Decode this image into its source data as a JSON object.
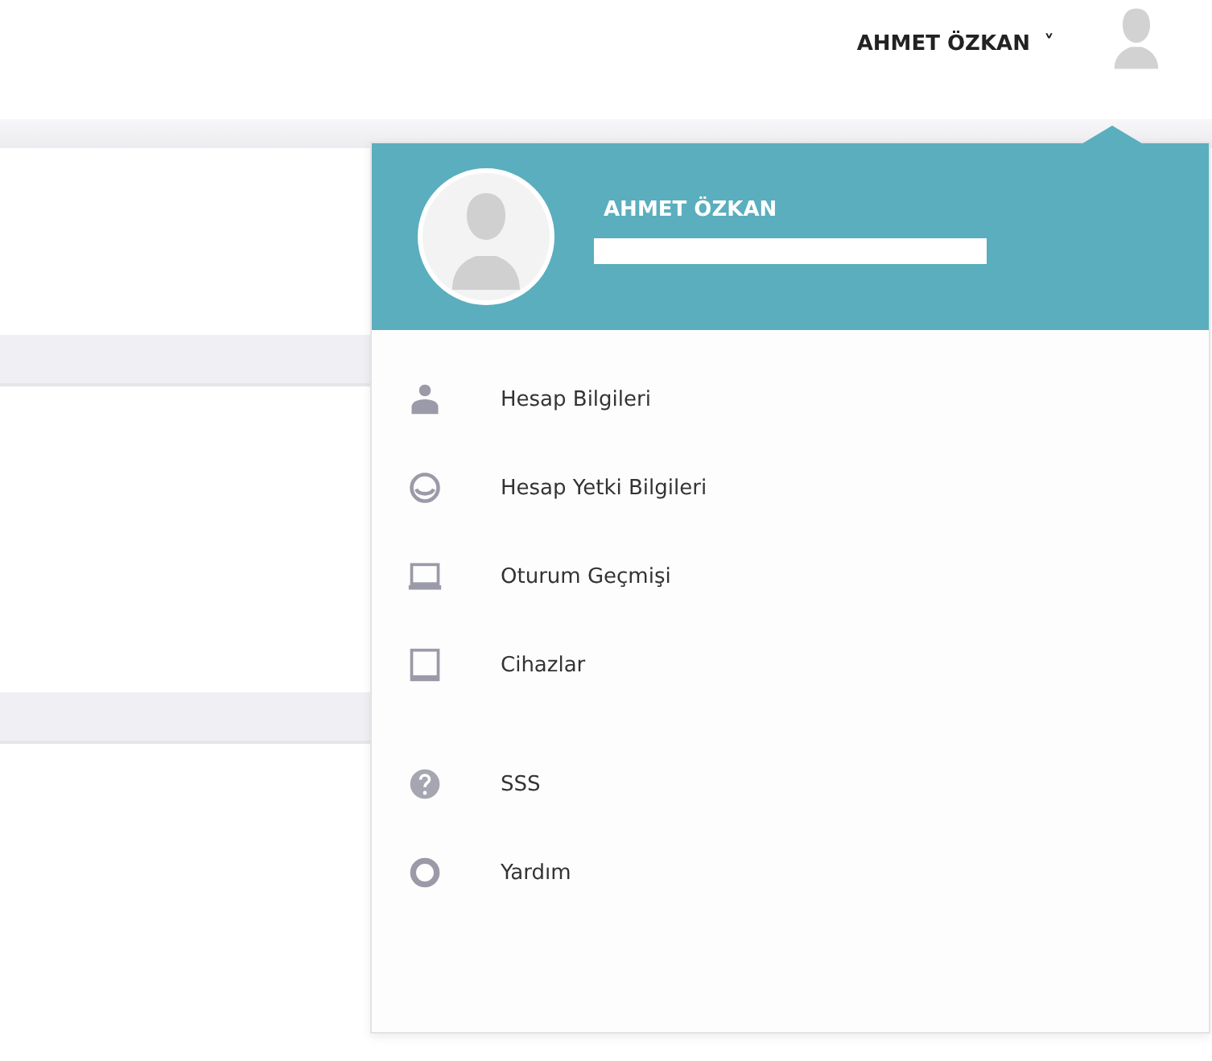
{
  "topbar": {
    "user_name": "AHMET ÖZKAN",
    "caret": "˅"
  },
  "dropdown": {
    "header": {
      "name": "AHMET ÖZKAN"
    },
    "groups": [
      [
        {
          "label": "Hesap Bilgileri"
        },
        {
          "label": "Hesap Yetki Bilgileri"
        },
        {
          "label": "Oturum Geçmişi"
        },
        {
          "label": "Cihazlar"
        }
      ],
      [
        {
          "label": "SSS"
        },
        {
          "label": "Yardım"
        }
      ]
    ]
  }
}
